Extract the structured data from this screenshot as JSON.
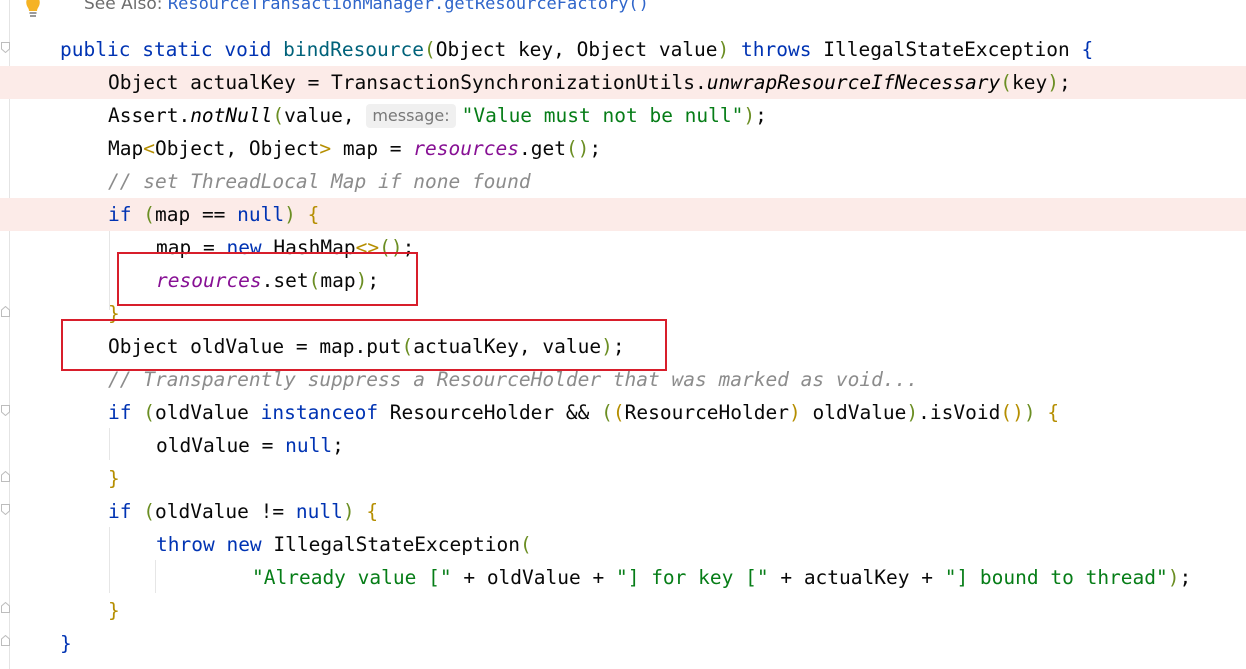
{
  "see_also": {
    "prefix": "See Also:",
    "link": "ResourceTransactionManager.getResourceFactory()"
  },
  "icons": {
    "intention": "lightbulb-icon",
    "fold": "fold-marker-icon"
  },
  "code": {
    "l1": {
      "kw1": "public",
      "kw2": "static",
      "kw3": "void",
      "name": "bindResource",
      "p1": "(",
      "sig": "Object key, Object value",
      "p2": ")",
      "kw4": "throws",
      "exc": "IllegalStateException",
      "brace": "{"
    },
    "l2": {
      "a": "Object actualKey = TransactionSynchronizationUtils.",
      "b": "unwrapResourceIfNecessary",
      "c": "(",
      "d": "key",
      "e": ")",
      "f": ";"
    },
    "l3": {
      "a": "Assert.",
      "b": "notNull",
      "c": "(",
      "d": "value, ",
      "hint": "message:",
      "str": "\"Value must not be null\"",
      "e": ")",
      "f": ";"
    },
    "l4": {
      "a": "Map",
      "b": "<",
      "c": "Object, Object",
      "d": ">",
      "e": " map = ",
      "field": "resources",
      "g": ".get",
      "h": "()",
      "i": ";"
    },
    "l5": {
      "cmt": "// set ThreadLocal Map if none found"
    },
    "l6": {
      "kw": "if",
      "a": " ",
      "p1": "(",
      "b": "map == ",
      "kw2": "null",
      "p2": ")",
      "c": " ",
      "brace": "{"
    },
    "l7": {
      "a": "map = ",
      "kw": "new",
      "b": " HashMap",
      "c": "<>",
      "d": "()",
      "e": ";"
    },
    "l8": {
      "field": "resources",
      "a": ".set",
      "p1": "(",
      "b": "map",
      "p2": ")",
      "c": ";"
    },
    "l9": {
      "brace": "}"
    },
    "l10": {
      "a": "Object oldValue = map.put",
      "p1": "(",
      "b": "actualKey, value",
      "p2": ")",
      "c": ";"
    },
    "l11": {
      "cmt": "// Transparently suppress a ResourceHolder that was marked as void..."
    },
    "l12": {
      "kw": "if",
      "a": " ",
      "p1": "(",
      "b": "oldValue ",
      "kw2": "instanceof",
      "c": " ResourceHolder && ",
      "p2": "(",
      "p3": "(",
      "d": "ResourceHolder",
      "p4": ")",
      "e": " oldValue",
      "p5": ")",
      "f": ".isVoid",
      "p6": "()",
      "p7": ")",
      "g": " ",
      "brace": "{"
    },
    "l13": {
      "a": "oldValue = ",
      "kw": "null",
      "b": ";"
    },
    "l14": {
      "brace": "}"
    },
    "l15": {
      "kw": "if",
      "a": " ",
      "p1": "(",
      "b": "oldValue != ",
      "kw2": "null",
      "p2": ")",
      "c": " ",
      "brace": "{"
    },
    "l16": {
      "kw": "throw",
      "a": " ",
      "kw2": "new",
      "b": " IllegalStateException",
      "p1": "("
    },
    "l17": {
      "s1": "\"Already value [\"",
      "a": " + oldValue + ",
      "s2": "\"] for key [\"",
      "b": " + actualKey + ",
      "s3": "\"] bound to thread\"",
      "p1": ")",
      "c": ";"
    },
    "l18": {
      "brace": "}"
    },
    "l19": {
      "brace": "}"
    }
  },
  "colors": {
    "highlight_bg": "#fcebe8",
    "box_red": "#d81e2b",
    "keyword": "#0033b3",
    "string": "#067d17",
    "field": "#871094",
    "comment": "#8c8c8c"
  }
}
